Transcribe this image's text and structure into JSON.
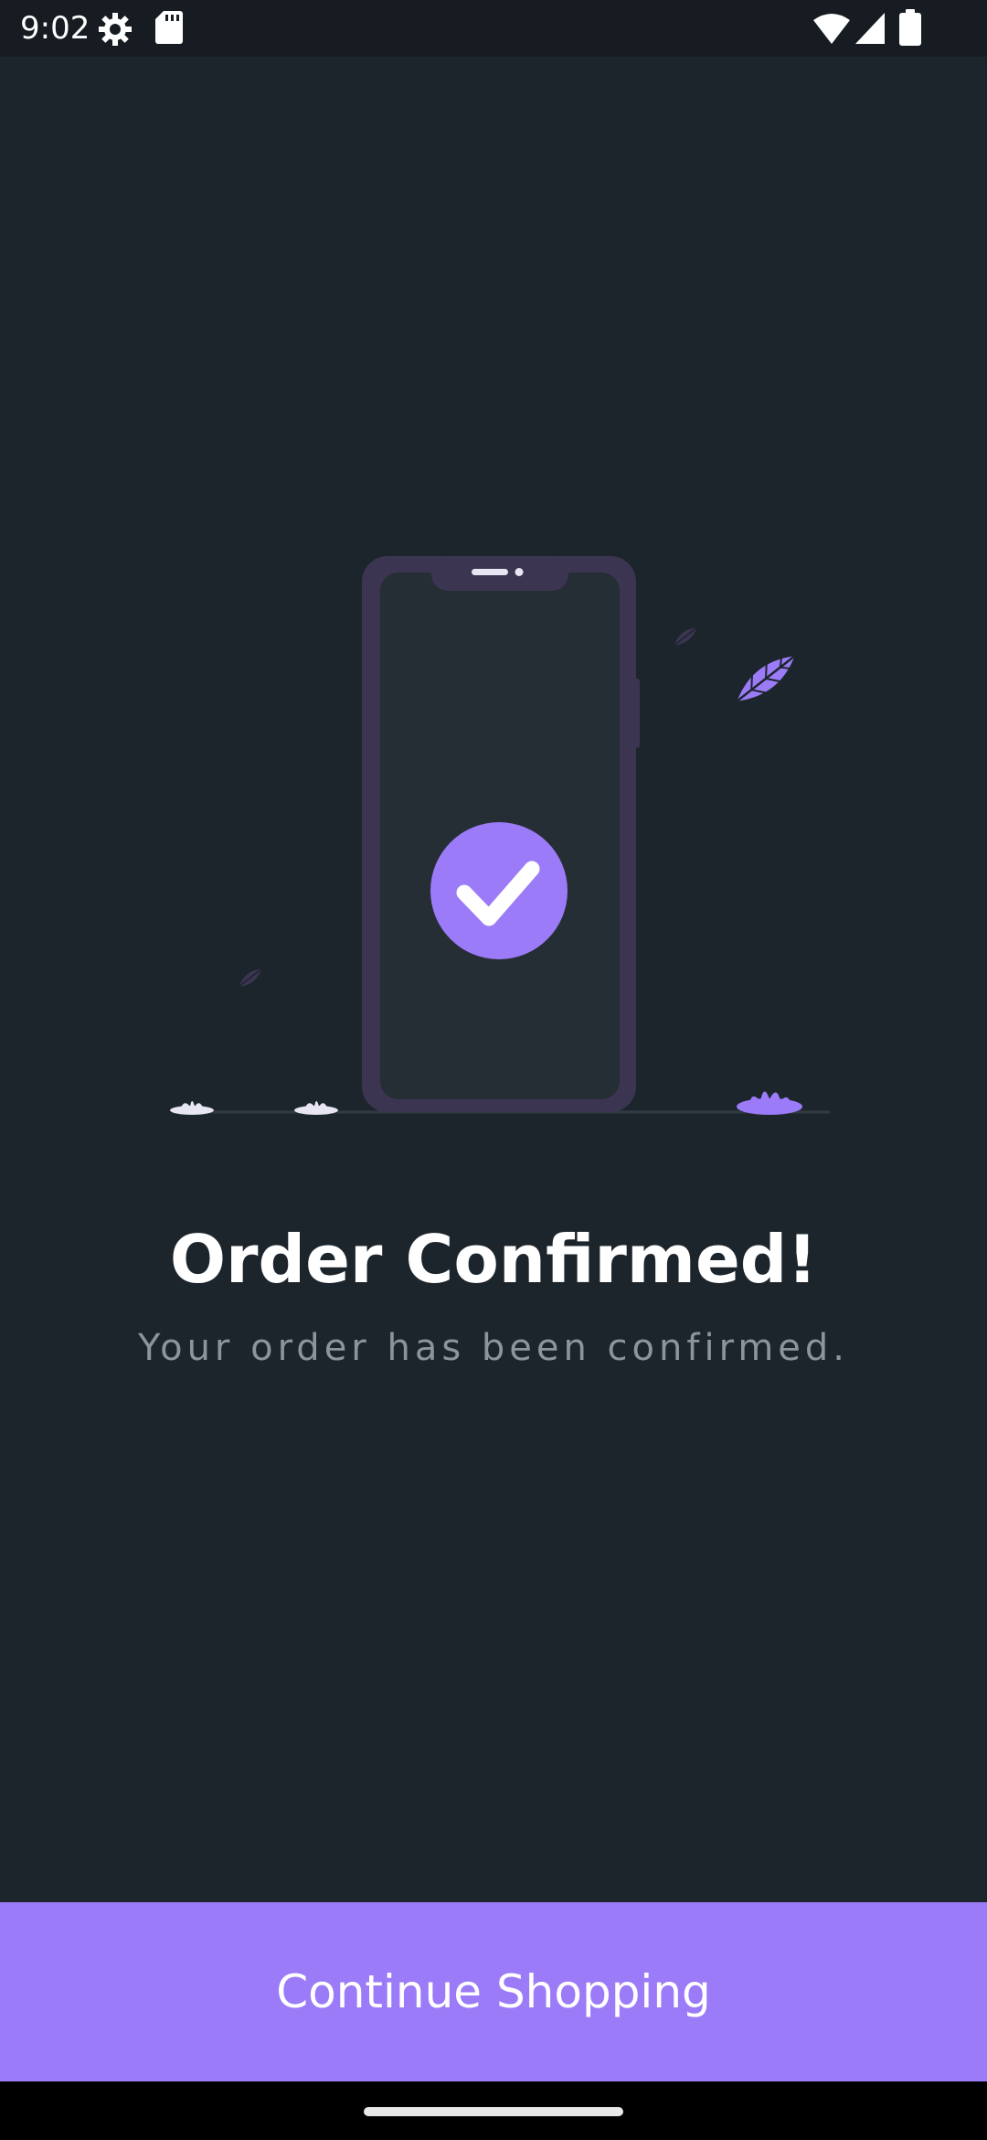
{
  "status_bar": {
    "time": "9:02",
    "icons": [
      "settings-icon",
      "sd-card-icon",
      "wifi-icon",
      "signal-icon",
      "battery-icon"
    ]
  },
  "confirmation": {
    "title": "Order Confirmed!",
    "subtitle": "Your order has been confirmed."
  },
  "actions": {
    "continue_label": "Continue Shopping"
  },
  "colors": {
    "background": "#1d252c",
    "accent": "#9b7bf7",
    "phone_frame": "#3b3551",
    "phone_screen": "#252d35",
    "subtitle": "#8d949c"
  }
}
